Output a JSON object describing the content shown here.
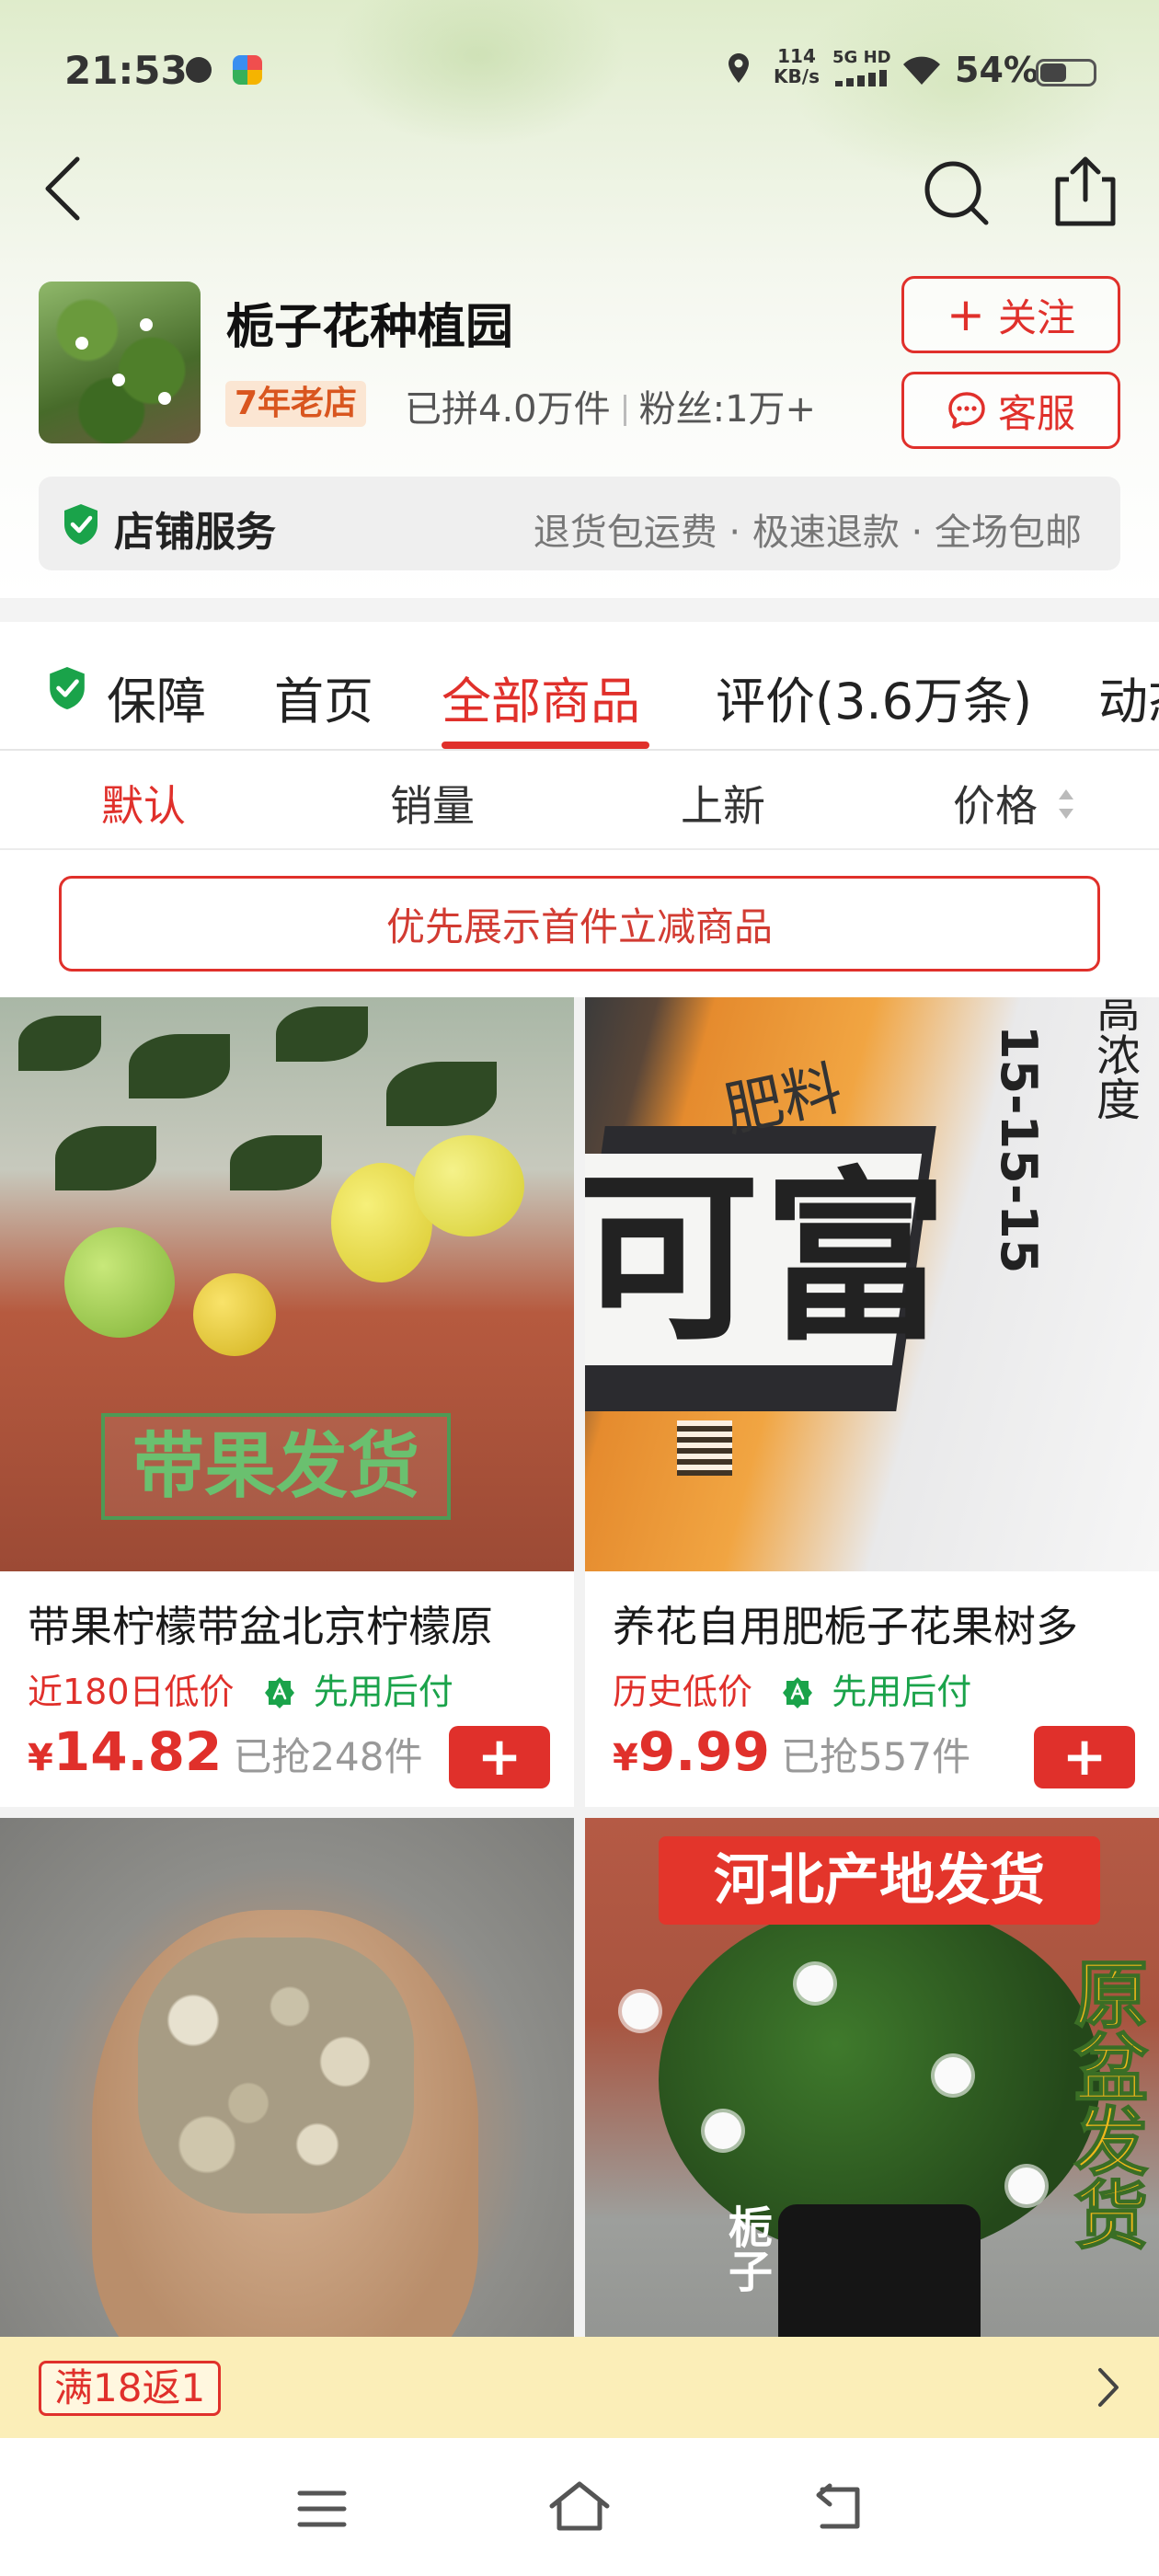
{
  "status_bar": {
    "time": "21:53",
    "net_speed_top": "114",
    "net_speed_bottom": "KB/s",
    "signal_label": "5G HD",
    "battery_percent": "54%",
    "battery_level": 0.54
  },
  "nav": {
    "back_icon": "chevron-left-icon",
    "search_icon": "search-icon",
    "share_icon": "share-icon"
  },
  "shop": {
    "name": "栀子花种植园",
    "age_badge": "7年老店",
    "sold": "已拼4.0万件",
    "fans": "粉丝:1万+",
    "follow_label": "关注",
    "service_label": "客服",
    "service_bar_title": "店铺服务",
    "service_bar_items": "退货包运费 · 极速退款 · 全场包邮"
  },
  "tabs": {
    "items": [
      "保障",
      "首页",
      "全部商品",
      "评价(3.6万条)",
      "动态"
    ],
    "active": "全部商品"
  },
  "sort": {
    "items": [
      "默认",
      "销量",
      "上新",
      "价格"
    ],
    "active": "默认"
  },
  "promo": {
    "label": "优先展示首件立减商品"
  },
  "products": [
    {
      "title": "带果柠檬带盆北京柠檬原",
      "tag_low": "近180日低价",
      "tag_pay": "先用后付",
      "price_symbol": "¥",
      "price": "14.82",
      "sold": "已抢248件",
      "image_caption": "带果发货"
    },
    {
      "title": "养花自用肥栀子花果树多",
      "tag_low": "历史低价",
      "tag_pay": "先用后付",
      "price_symbol": "¥",
      "price": "9.99",
      "sold": "已抢557件",
      "image_text_big": "可富",
      "image_text_small": "肥料",
      "image_text_vertical": "15-15-15",
      "image_text_vertical2": "高浓度"
    },
    {
      "title": "",
      "image_alt": "pebbles-in-hand"
    },
    {
      "title": "",
      "image_banner": "河北产地发货",
      "image_side_text": "原盆发货",
      "image_pot_text": "栀子"
    }
  ],
  "coupon": {
    "label": "满18返1"
  },
  "colors": {
    "accent": "#e0302b",
    "green": "#1aa34a",
    "coupon_bg": "#fbeeb8"
  }
}
